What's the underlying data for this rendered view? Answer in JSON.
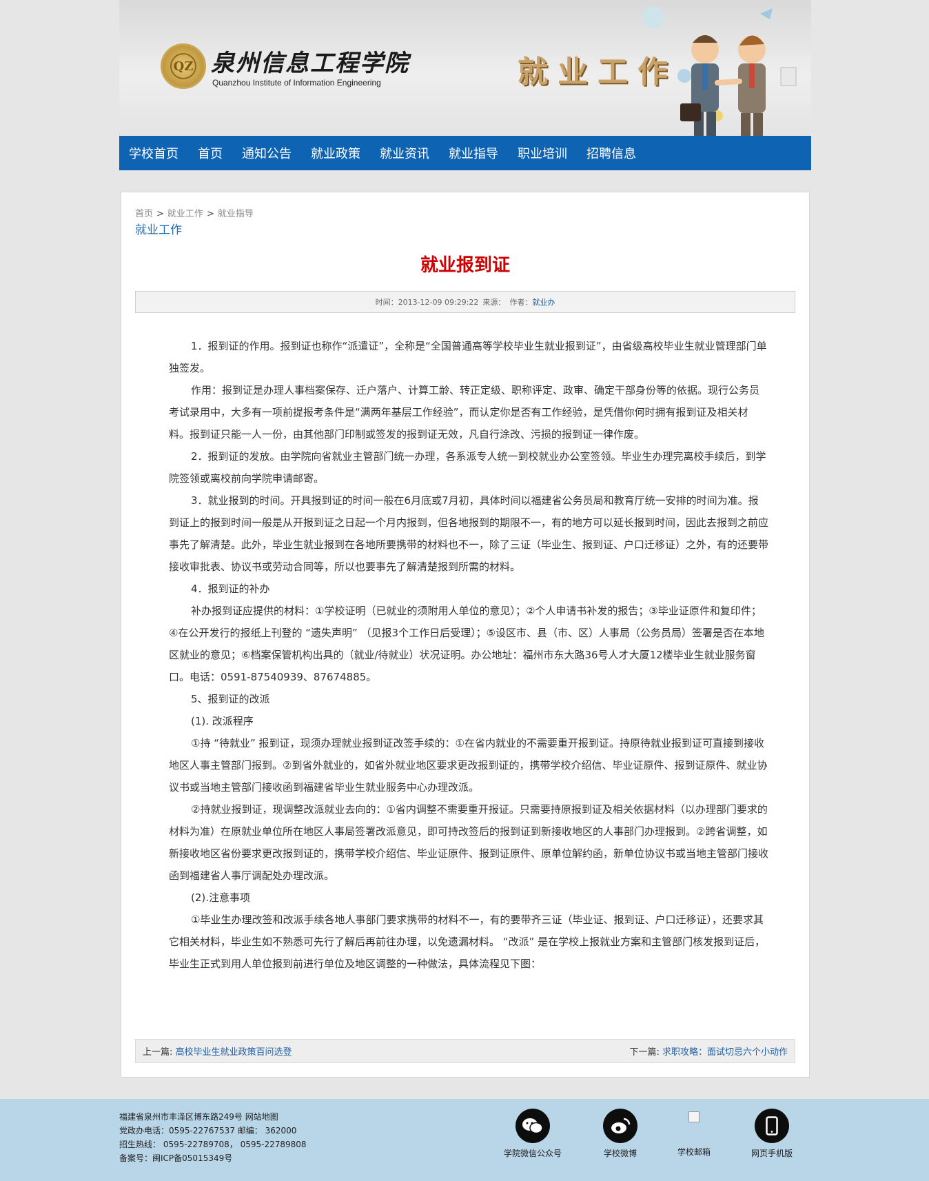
{
  "header": {
    "logo_seal_text": "QZ",
    "school_name_cn": "泉州信息工程学院",
    "school_name_en": "Quanzhou Institute of Information Engineering",
    "banner_title": "就业工作"
  },
  "nav": {
    "items": [
      "学校首页",
      "首页",
      "通知公告",
      "就业政策",
      "就业资讯",
      "就业指导",
      "职业培训",
      "招聘信息"
    ]
  },
  "breadcrumb": {
    "home": "首页",
    "level1": "就业工作",
    "level2": "就业指导",
    "separator": ">"
  },
  "section_name": "就业工作",
  "article": {
    "title": "就业报到证",
    "meta_time_label": "时间：",
    "meta_time": "2013-12-09 09:29:22",
    "meta_source_label": "来源：",
    "meta_author_label": "作者：",
    "meta_author": "就业办",
    "paragraphs": [
      "1．报到证的作用。报到证也称作“派遣证”，全称是“全国普通高等学校毕业生就业报到证”，由省级高校毕业生就业管理部门单独签发。",
      "作用：报到证是办理人事档案保存、迁户落户、计算工龄、转正定级、职称评定、政审、确定干部身份等的依据。现行公务员考试录用中，大多有一项前提报考条件是“满两年基层工作经验”，而认定你是否有工作经验，是凭借你何时拥有报到证及相关材料。报到证只能一人一份，由其他部门印制或签发的报到证无效，凡自行涂改、污损的报到证一律作废。",
      "2．报到证的发放。由学院向省就业主管部门统一办理，各系派专人统一到校就业办公室签领。毕业生办理完离校手续后，到学院签领或离校前向学院申请邮寄。",
      "3．就业报到的时间。开具报到证的时间一般在6月底或7月初，具体时间以福建省公务员局和教育厅统一安排的时间为准。报到证上的报到时间一般是从开报到证之日起一个月内报到，但各地报到的期限不一，有的地方可以延长报到时间，因此去报到之前应事先了解清楚。此外，毕业生就业报到在各地所要携带的材料也不一，除了三证（毕业生、报到证、户口迁移证）之外，有的还要带接收审批表、协议书或劳动合同等，所以也要事先了解清楚报到所需的材料。",
      "4．报到证的补办",
      "补办报到证应提供的材料：①学校证明（已就业的须附用人单位的意见）；②个人申请书补发的报告；③毕业证原件和复印件；④在公开发行的报纸上刊登的 “遗失声明” （见报3个工作日后受理）；⑤设区市、县（市、区）人事局（公务员局）签署是否在本地区就业的意见；⑥档案保管机构出具的（就业/待就业）状况证明。办公地址：福州市东大路36号人才大厦12楼毕业生就业服务窗口。电话：0591-87540939、87674885。",
      "5、报到证的改派",
      "(1). 改派程序",
      " ①持 “待就业” 报到证，现须办理就业报到证改签手续的：①在省内就业的不需要重开报到证。持原待就业报到证可直接到接收地区人事主管部门报到。②到省外就业的，如省外就业地区要求更改报到证的，携带学校介绍信、毕业证原件、报到证原件、就业协议书或当地主管部门接收函到福建省毕业生就业服务中心办理改派。",
      "②持就业报到证，现调整改派就业去向的：①省内调整不需要重开报证。只需要持原报到证及相关依据材料（以办理部门要求的材料为准）在原就业单位所在地区人事局签署改派意见，即可持改签后的报到证到新接收地区的人事部门办理报到。②跨省调整，如新接收地区省份要求更改报到证的，携带学校介绍信、毕业证原件、报到证原件、原单位解约函，新单位协议书或当地主管部门接收函到福建省人事厅调配处办理改派。",
      " (2).注意事项",
      "①毕业生办理改签和改派手续各地人事部门要求携带的材料不一，有的要带齐三证（毕业证、报到证、户口迁移证），还要求其它相关材料，毕业生如不熟悉可先行了解后再前往办理，以免遗漏材料。 “改派” 是在学校上报就业方案和主管部门核发报到证后，毕业生正式到用人单位报到前进行单位及地区调整的一种做法，具体流程见下图："
    ],
    "prev_label": "上一篇:",
    "prev_title": "高校毕业生就业政策百问选登",
    "next_label": "下一篇:",
    "next_title": "求职攻略：面试切忌六个小动作"
  },
  "footer": {
    "lines": [
      "福建省泉州市丰泽区博东路249号  网站地图",
      "党政办电话：0595-22767537  邮编：  362000",
      "招生热线：  0595-22789708，  0595-22789808",
      "备案号：闽ICP备05015349号"
    ],
    "links": [
      {
        "label": "学院微信公众号",
        "icon": "wechat-icon"
      },
      {
        "label": "学校微博",
        "icon": "weibo-icon"
      },
      {
        "label": "学校邮箱",
        "icon": "broken-image-icon"
      },
      {
        "label": "网页手机版",
        "icon": "mobile-phone-icon"
      }
    ]
  },
  "colors": {
    "nav_bg": "#0f63b3",
    "title_red": "#cc0000",
    "link_blue": "#1f5fa8",
    "footer_bg": "#b9d5e8"
  }
}
